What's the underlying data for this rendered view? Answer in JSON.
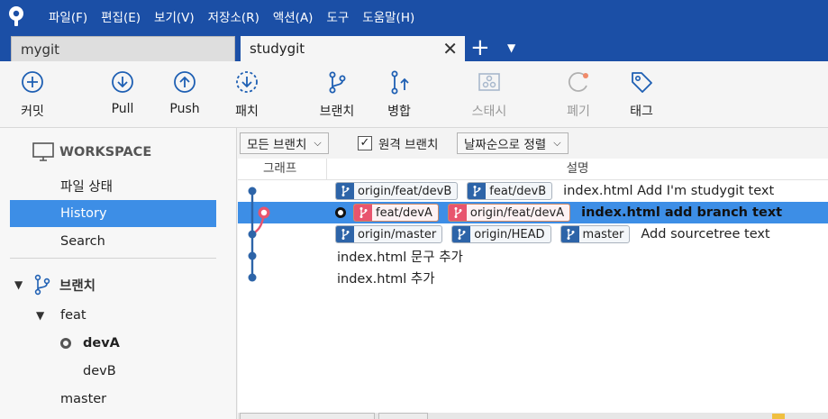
{
  "menu": [
    "파일(F)",
    "편집(E)",
    "보기(V)",
    "저장소(R)",
    "액션(A)",
    "도구",
    "도움말(H)"
  ],
  "tabs": [
    {
      "label": "mygit",
      "active": false
    },
    {
      "label": "studygit",
      "active": true
    }
  ],
  "tab_add_symbol": "+",
  "tab_close_symbol": "✕",
  "toolbar": {
    "commit": "커밋",
    "pull": "Pull",
    "push": "Push",
    "fetch": "패치",
    "branch": "브랜치",
    "merge": "병합",
    "stash": "스태시",
    "discard": "폐기",
    "tag": "태그"
  },
  "sidebar": {
    "workspace": "WORKSPACE",
    "file_status": "파일 상태",
    "history": "History",
    "search": "Search",
    "branches": "브랜치",
    "feat": "feat",
    "devA": "devA",
    "devB": "devB",
    "master": "master"
  },
  "filters": {
    "all_branches": "모든 브랜치",
    "remote_branches": "원격 브랜치",
    "remote_checked": true,
    "sort": "날짜순으로 정렬"
  },
  "columns": {
    "graph": "그래프",
    "description": "설명"
  },
  "commits": [
    {
      "refs": [
        {
          "name": "origin/feat/devB",
          "style": "blue"
        },
        {
          "name": "feat/devB",
          "style": "blue"
        }
      ],
      "message": "index.html Add I'm studygit text",
      "selected": false
    },
    {
      "refs": [
        {
          "name": "feat/devA",
          "style": "red"
        },
        {
          "name": "origin/feat/devA",
          "style": "red"
        }
      ],
      "message": "index.html add branch text",
      "selected": true,
      "is_head": true
    },
    {
      "refs": [
        {
          "name": "origin/master",
          "style": "blue"
        },
        {
          "name": "origin/HEAD",
          "style": "blue"
        },
        {
          "name": "master",
          "style": "blue"
        }
      ],
      "message": "Add sourcetree text",
      "selected": false
    },
    {
      "refs": [],
      "message": "index.html 문구 추가",
      "selected": false
    },
    {
      "refs": [],
      "message": "index.html 추가",
      "selected": false
    }
  ],
  "colors": {
    "menubar": "#1b4fa6",
    "selection": "#3d8ee6",
    "graph_line": "#2d64a8",
    "branch_head": "#e8546e",
    "icon_blue": "#1e5fb3"
  }
}
